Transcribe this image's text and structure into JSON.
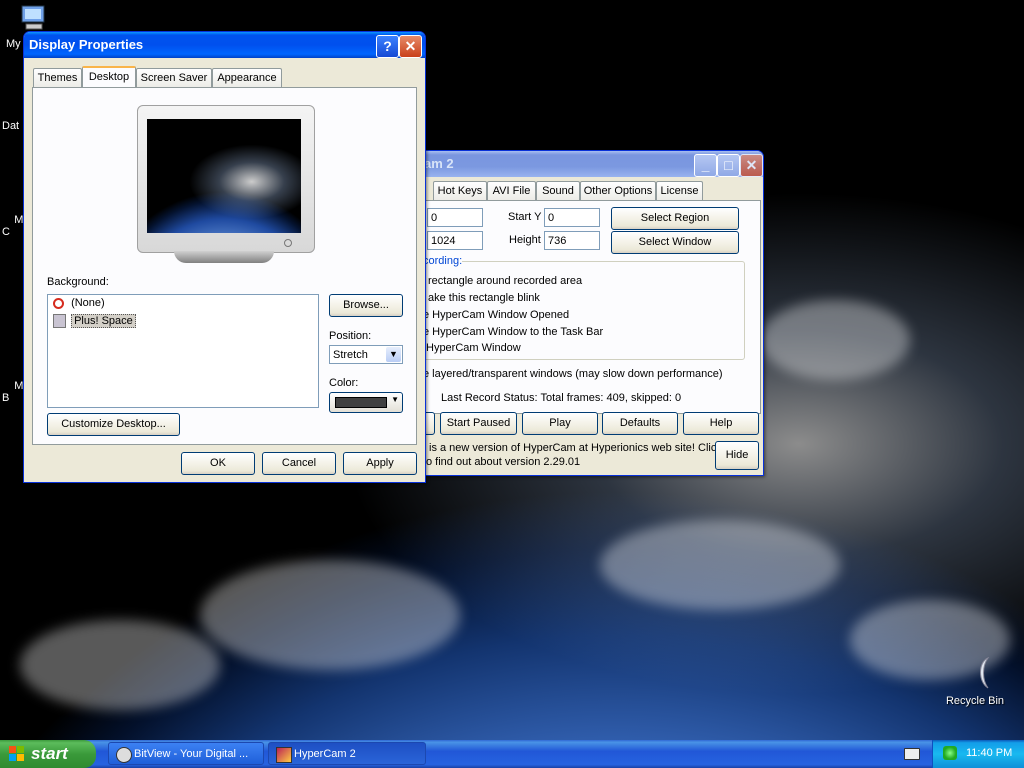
{
  "desktop": {
    "icons": [
      {
        "label": "My"
      },
      {
        "label": "Dat"
      },
      {
        "label": "Micro\nC"
      },
      {
        "label": "Micro\nB"
      },
      {
        "label": "Recycle Bin"
      }
    ]
  },
  "display_properties": {
    "title": "Display Properties",
    "help_button": "?",
    "close_button": "✕",
    "tabs": [
      "Themes",
      "Desktop",
      "Screen Saver",
      "Appearance"
    ],
    "active_tab": "Desktop",
    "background_label": "Background:",
    "background_items": [
      "(None)",
      "Plus! Space"
    ],
    "selected_background": "Plus! Space",
    "browse_button": "Browse...",
    "position_label": "Position:",
    "position_value": "Stretch",
    "color_label": "Color:",
    "color_value": "#404040",
    "customize_button": "Customize Desktop...",
    "ok_button": "OK",
    "cancel_button": "Cancel",
    "apply_button": "Apply"
  },
  "hypercam": {
    "title_partial": "am 2",
    "tabs": [
      "Hot Keys",
      "AVI File",
      "Sound",
      "Other Options",
      "License"
    ],
    "start_x_value": "0",
    "start_y_label": "Start Y",
    "start_y_value": "0",
    "width_value": "1024",
    "height_label": "Height",
    "height_value": "736",
    "select_region_button": "Select Region",
    "select_window_button": "Select Window",
    "group_label": "cording:",
    "options": [
      "rectangle around recorded area",
      "ake this rectangle blink",
      "e HyperCam Window Opened",
      "e HyperCam Window to the Task Bar",
      "HyperCam Window"
    ],
    "layered_option": "e layered/transparent windows (may slow down performance)",
    "status": "Last Record Status: Total frames: 409, skipped: 0",
    "start_paused_button": "Start Paused",
    "play_button": "Play",
    "defaults_button": "Defaults",
    "help_button": "Help",
    "update_notice_line1": "is a new version of HyperCam at Hyperionics web site! Click",
    "update_notice_line2": "o find out about version 2.29.01",
    "hide_button": "Hide"
  },
  "taskbar": {
    "start_label": "start",
    "items": [
      {
        "label": "BitView - Your Digital ...",
        "icon": "bitview-icon"
      },
      {
        "label": "HyperCam 2",
        "icon": "hypercam-icon"
      }
    ],
    "clock": "11:40 PM"
  }
}
